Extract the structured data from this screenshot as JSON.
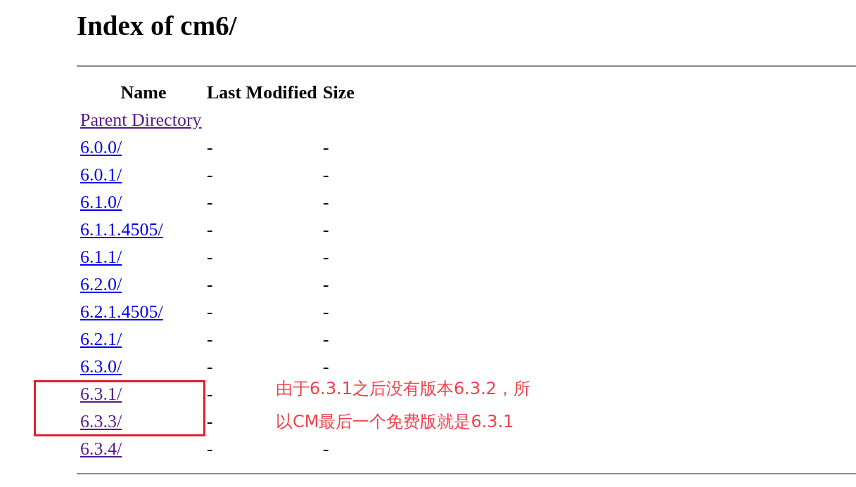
{
  "title": "Index of cm6/",
  "table": {
    "columns": [
      "Name",
      "Last Modified",
      "Size"
    ],
    "rows": [
      {
        "name": "Parent Directory",
        "visited": true
      },
      {
        "name": "6.0.0/",
        "visited": false,
        "last_modified": "-",
        "size": "-"
      },
      {
        "name": "6.0.1/",
        "visited": false,
        "last_modified": "-",
        "size": "-"
      },
      {
        "name": "6.1.0/",
        "visited": false,
        "last_modified": "-",
        "size": "-"
      },
      {
        "name": "6.1.1.4505/",
        "visited": false,
        "last_modified": "-",
        "size": "-"
      },
      {
        "name": "6.1.1/",
        "visited": false,
        "last_modified": "-",
        "size": "-"
      },
      {
        "name": "6.2.0/",
        "visited": false,
        "last_modified": "-",
        "size": "-"
      },
      {
        "name": "6.2.1.4505/",
        "visited": false,
        "last_modified": "-",
        "size": "-"
      },
      {
        "name": "6.2.1/",
        "visited": false,
        "last_modified": "-",
        "size": "-"
      },
      {
        "name": "6.3.0/",
        "visited": false,
        "last_modified": "-",
        "size": "-"
      },
      {
        "name": "6.3.1/",
        "visited": true,
        "last_modified": "-"
      },
      {
        "name": "6.3.3/",
        "visited": true,
        "last_modified": "-"
      },
      {
        "name": "6.3.4/",
        "visited": true,
        "last_modified": "-",
        "size": "-"
      }
    ]
  },
  "annotation": {
    "lines": [
      "由于6.3.1之后没有版本6.3.2，所",
      "以CM最后一个免费版就是6.3.1"
    ]
  }
}
